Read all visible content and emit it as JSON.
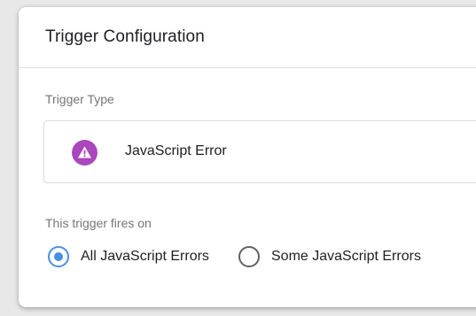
{
  "dialog": {
    "title": "Trigger Configuration"
  },
  "trigger_type": {
    "label": "Trigger Type",
    "name": "JavaScript Error",
    "icon": "warning-triangle-icon",
    "icon_color": "#ab47bc"
  },
  "fires_on": {
    "label": "This trigger fires on",
    "options": [
      {
        "label": "All JavaScript Errors",
        "selected": true
      },
      {
        "label": "Some JavaScript Errors",
        "selected": false
      }
    ],
    "accent_color": "#4a90e2"
  }
}
